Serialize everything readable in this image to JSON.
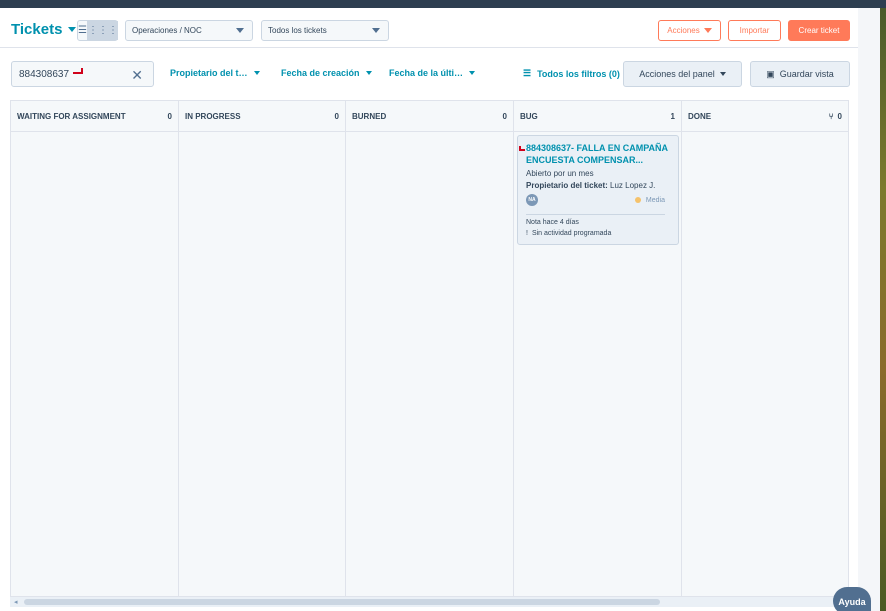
{
  "header": {
    "title": "Tickets",
    "pipeline_select": "Operaciones / NOC",
    "view_select": "Todos los tickets",
    "actions_button": "Acciones",
    "import_button": "Importar",
    "create_button": "Crear ticket"
  },
  "filters": {
    "search_value": "884308637",
    "owner_filter": "Propietario del t…",
    "created_filter": "Fecha de creación",
    "last_filter": "Fecha de la últi…",
    "all_filters": "Todos los filtros (0)",
    "panel_actions": "Acciones del panel",
    "save_view": "Guardar vista"
  },
  "board": {
    "columns": [
      {
        "name": "WAITING FOR ASSIGNMENT",
        "count": "0"
      },
      {
        "name": "IN PROGRESS",
        "count": "0"
      },
      {
        "name": "BURNED",
        "count": "0"
      },
      {
        "name": "BUG",
        "count": "1"
      },
      {
        "name": "DONE",
        "count": "0"
      }
    ],
    "card": {
      "title": "884308637- FALLA EN CAMPAÑA ENCUESTA COMPENSAR...",
      "status": "Abierto por un mes",
      "owner_label": "Propietario del ticket:",
      "owner_name": "Luz Lopez J.",
      "avatar_initials": "NA",
      "priority": "Media",
      "note": "Nota hace 4 días",
      "activity": "Sin actividad programada"
    }
  },
  "help_button": "Ayuda"
}
